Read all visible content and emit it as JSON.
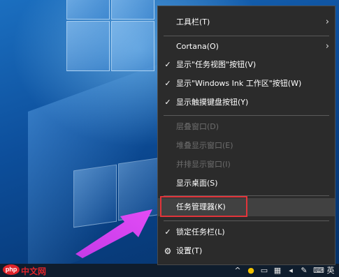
{
  "context_menu": {
    "items": {
      "toolbars": "工具栏(T)",
      "cortana": "Cortana(O)",
      "show_task_view": "显示\"任务视图\"按钮(V)",
      "show_ink_workspace": "显示\"Windows Ink 工作区\"按钮(W)",
      "show_touch_keyboard": "显示触摸键盘按钮(Y)",
      "cascade": "层叠窗口(D)",
      "stacked": "堆叠显示窗口(E)",
      "side_by_side": "并排显示窗口(I)",
      "show_desktop": "显示桌面(S)",
      "task_manager": "任务管理器(K)",
      "lock_taskbar": "锁定任务栏(L)",
      "settings": "设置(T)"
    },
    "check_glyph": "✓",
    "chevron_glyph": "›",
    "gear_glyph": "⚙",
    "highlight_color": "#e2343a",
    "background_color": "#2b2b2b"
  },
  "taskbar": {
    "watermark_logo": "php",
    "watermark_site": "中文网",
    "tray_ime": "英",
    "tray_caret": "^"
  },
  "annotation": {
    "arrow_color": "#d23ff0"
  }
}
